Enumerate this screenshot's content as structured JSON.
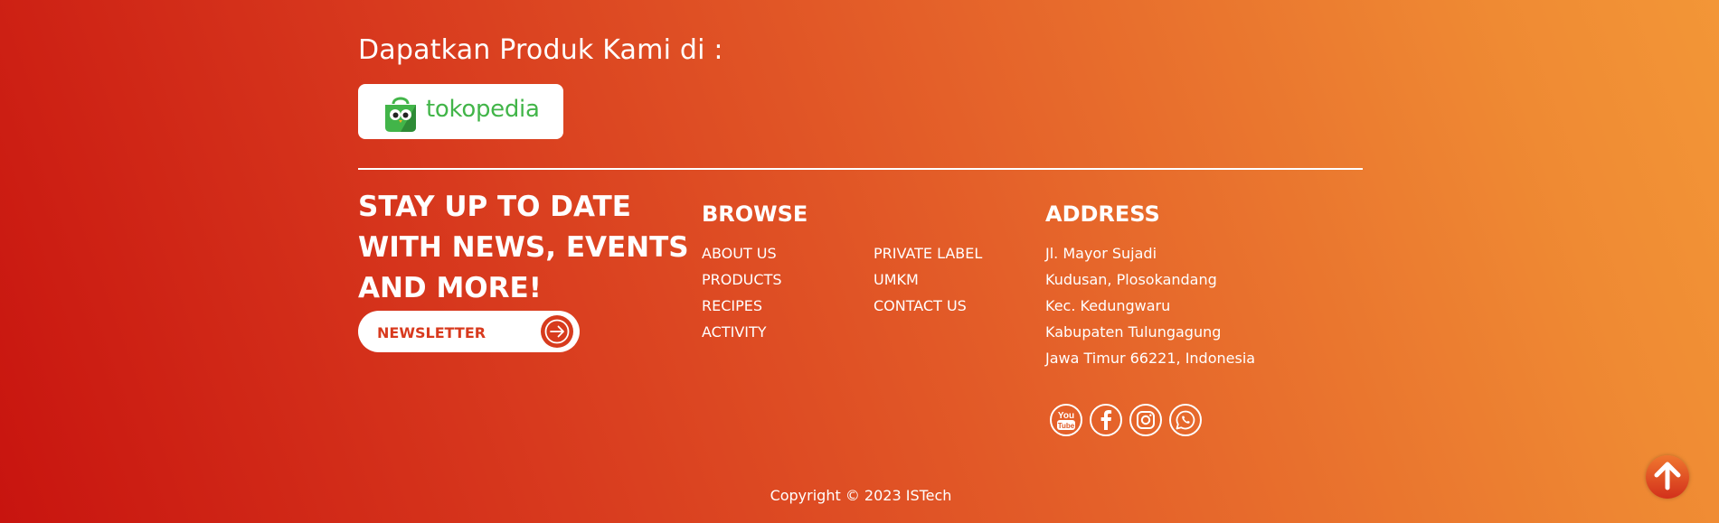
{
  "marketplace": {
    "heading": "Dapatkan Produk Kami di :",
    "store_name": "tokopedia",
    "store_icon": "tokopedia-owl-bag-icon",
    "store_color": "#42b549"
  },
  "newsletter": {
    "heading_lines": [
      "STAY UP TO DATE",
      "WITH NEWS, EVENTS",
      "AND MORE!"
    ],
    "button_label": "NEWSLETTER",
    "button_icon": "arrow-right-icon"
  },
  "browse": {
    "title": "BROWSE",
    "column_1": [
      "ABOUT US",
      "PRODUCTS",
      "RECIPES",
      "ACTIVITY"
    ],
    "column_2": [
      "PRIVATE LABEL",
      "UMKM",
      "CONTACT US"
    ]
  },
  "address": {
    "title": "ADDRESS",
    "lines": [
      "Jl. Mayor Sujadi",
      "Kudusan, Plosokandang",
      "Kec. Kedungwaru",
      "Kabupaten Tulungagung",
      "Jawa Timur 66221, Indonesia"
    ]
  },
  "social": [
    {
      "icon": "youtube-icon"
    },
    {
      "icon": "facebook-icon"
    },
    {
      "icon": "instagram-icon"
    },
    {
      "icon": "whatsapp-icon"
    }
  ],
  "footer": {
    "copyright": "Copyright © 2023 ISTech"
  },
  "scroll_top_icon": "arrow-up-icon",
  "colors": {
    "gradient_start": "#c8140f",
    "gradient_end": "#f39637",
    "accent": "#d83a1e"
  }
}
